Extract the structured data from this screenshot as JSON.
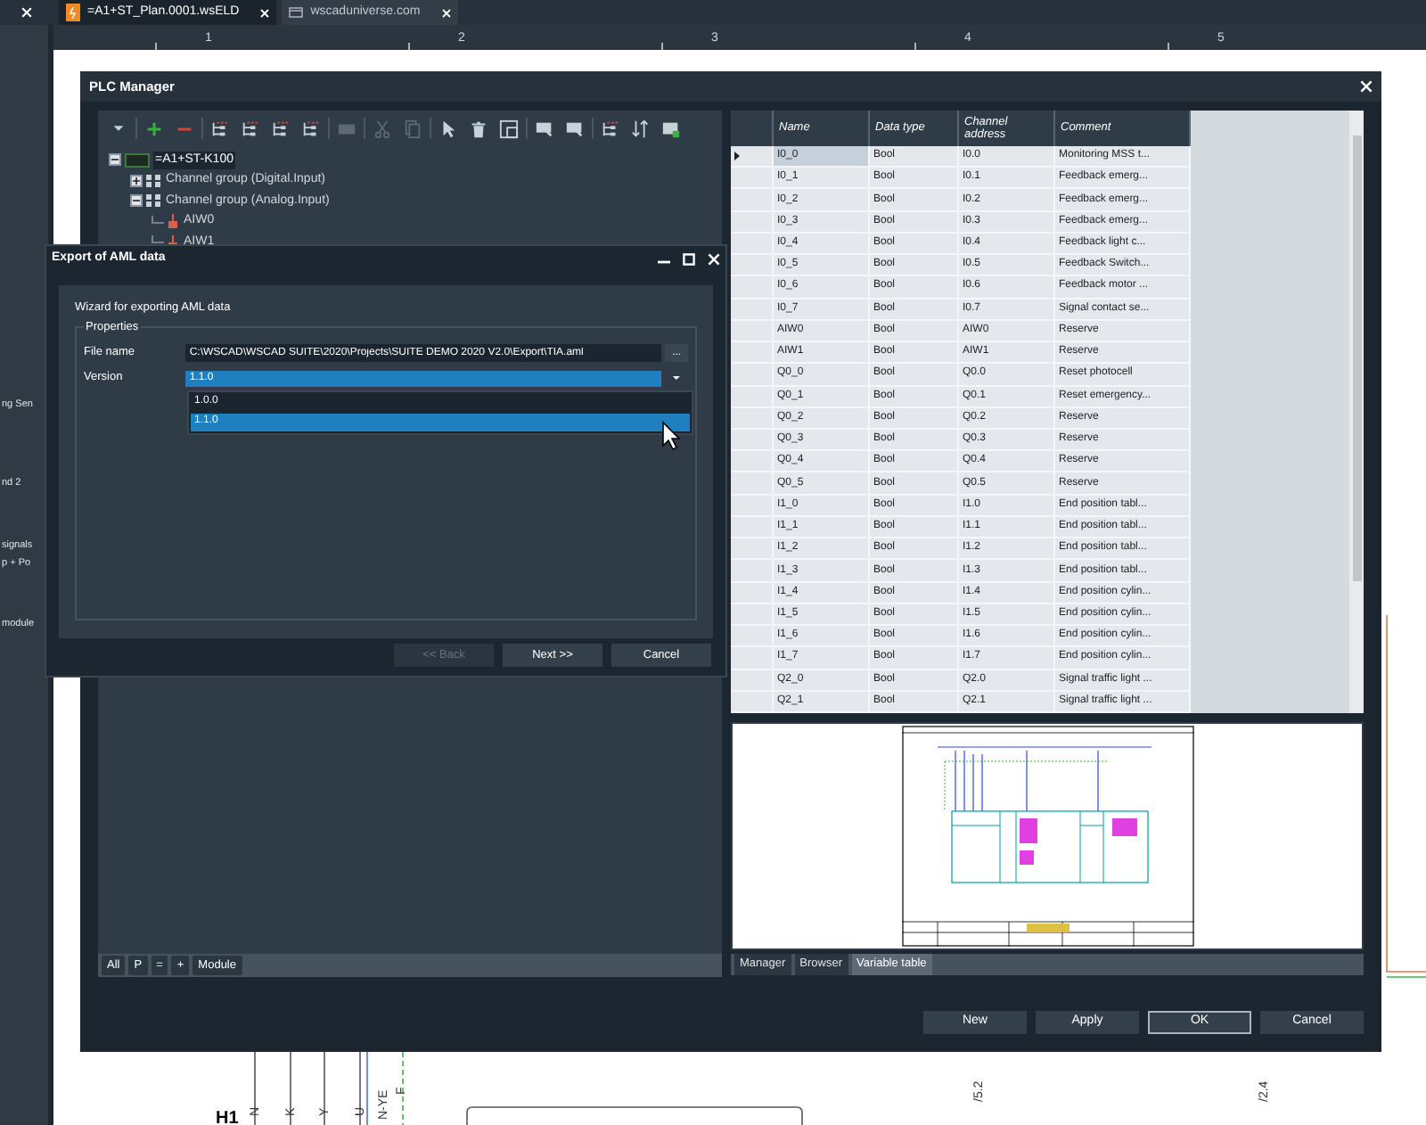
{
  "document_tabs": [
    {
      "label": "=A1+ST_Plan.0001.wsELD",
      "selected": true
    },
    {
      "label": "wscaduniverse.com",
      "selected": false
    }
  ],
  "side_panel": {
    "items": [
      "ng Sen",
      "nd 2",
      "signals",
      "p + Po",
      "module"
    ]
  },
  "ruler": [
    "1",
    "2",
    "3",
    "4",
    "5"
  ],
  "drawing_labels": [
    {
      "kind": "wire",
      "text": "N"
    },
    {
      "kind": "wire",
      "text": "K"
    },
    {
      "kind": "wire",
      "text": "Y"
    },
    {
      "kind": "wire",
      "text": "U"
    },
    {
      "kind": "wire",
      "text": "N-YE"
    },
    {
      "kind": "wire",
      "text": "F"
    },
    {
      "kind": "reference",
      "text": "/5.2"
    },
    {
      "kind": "reference",
      "text": "/2.4"
    },
    {
      "kind": "device",
      "text": "H1"
    }
  ],
  "plc_manager": {
    "title": "PLC Manager",
    "toolbar": [
      [
        {
          "kind": "dropdown",
          "disabled": false
        }
      ],
      [
        {
          "kind": "add",
          "disabled": false
        },
        {
          "kind": "remove",
          "disabled": false
        }
      ],
      [
        {
          "kind": "tree",
          "disabled": false
        },
        {
          "kind": "tree",
          "disabled": false
        },
        {
          "kind": "tree",
          "disabled": false
        },
        {
          "kind": "tree",
          "disabled": false
        }
      ],
      [
        {
          "kind": "module",
          "disabled": true
        }
      ],
      [
        {
          "kind": "cut",
          "disabled": true
        },
        {
          "kind": "copy",
          "disabled": true
        }
      ],
      [
        {
          "kind": "pointer",
          "disabled": false
        },
        {
          "kind": "delete",
          "disabled": false
        },
        {
          "kind": "layout",
          "disabled": false
        }
      ],
      [
        {
          "kind": "import",
          "disabled": false
        },
        {
          "kind": "import",
          "disabled": false
        }
      ],
      [
        {
          "kind": "tree",
          "disabled": false
        },
        {
          "kind": "sort",
          "disabled": false
        },
        {
          "kind": "export",
          "disabled": false
        }
      ]
    ],
    "tree": [
      {
        "kind": "module",
        "label": "=A1+ST-K100",
        "selected": true,
        "expanded": true,
        "children": [
          {
            "kind": "group",
            "label": "Channel group (Digital.Input)",
            "selected": false,
            "expanded": false
          },
          {
            "kind": "group",
            "label": "Channel group (Analog.Input)",
            "selected": false,
            "expanded": true,
            "children": [
              {
                "kind": "channel",
                "label": "AIW0",
                "selected": false
              },
              {
                "kind": "channel",
                "label": "AIW1",
                "selected": false
              }
            ]
          }
        ]
      }
    ],
    "filter_tabs": [
      "All",
      "P",
      "=",
      "+",
      "Module"
    ],
    "table": {
      "columns": [
        "Name",
        "Data type",
        "Channel address",
        "Comment"
      ],
      "rows": [
        {
          "selected": true,
          "cells": [
            "I0_0",
            "Bool",
            "I0.0",
            "Monitoring MSS t..."
          ]
        },
        {
          "selected": false,
          "cells": [
            "I0_1",
            "Bool",
            "I0.1",
            "Feedback emerg..."
          ]
        },
        {
          "selected": false,
          "cells": [
            "I0_2",
            "Bool",
            "I0.2",
            "Feedback emerg..."
          ]
        },
        {
          "selected": false,
          "cells": [
            "I0_3",
            "Bool",
            "I0.3",
            "Feedback emerg..."
          ]
        },
        {
          "selected": false,
          "cells": [
            "I0_4",
            "Bool",
            "I0.4",
            "Feedback light c..."
          ]
        },
        {
          "selected": false,
          "cells": [
            "I0_5",
            "Bool",
            "I0.5",
            "Feedback Switch..."
          ]
        },
        {
          "selected": false,
          "cells": [
            "I0_6",
            "Bool",
            "I0.6",
            "Feedback motor ..."
          ]
        },
        {
          "selected": false,
          "cells": [
            "I0_7",
            "Bool",
            "I0.7",
            "Signal contact se..."
          ]
        },
        {
          "selected": false,
          "cells": [
            "AIW0",
            "Bool",
            "AIW0",
            "Reserve"
          ]
        },
        {
          "selected": false,
          "cells": [
            "AIW1",
            "Bool",
            "AIW1",
            "Reserve"
          ]
        },
        {
          "selected": false,
          "cells": [
            "Q0_0",
            "Bool",
            "Q0.0",
            "Reset photocell"
          ]
        },
        {
          "selected": false,
          "cells": [
            "Q0_1",
            "Bool",
            "Q0.1",
            "Reset emergency..."
          ]
        },
        {
          "selected": false,
          "cells": [
            "Q0_2",
            "Bool",
            "Q0.2",
            "Reserve"
          ]
        },
        {
          "selected": false,
          "cells": [
            "Q0_3",
            "Bool",
            "Q0.3",
            "Reserve"
          ]
        },
        {
          "selected": false,
          "cells": [
            "Q0_4",
            "Bool",
            "Q0.4",
            "Reserve"
          ]
        },
        {
          "selected": false,
          "cells": [
            "Q0_5",
            "Bool",
            "Q0.5",
            "Reserve"
          ]
        },
        {
          "selected": false,
          "cells": [
            "I1_0",
            "Bool",
            "I1.0",
            "End position tabl..."
          ]
        },
        {
          "selected": false,
          "cells": [
            "I1_1",
            "Bool",
            "I1.1",
            "End position tabl..."
          ]
        },
        {
          "selected": false,
          "cells": [
            "I1_2",
            "Bool",
            "I1.2",
            "End position tabl..."
          ]
        },
        {
          "selected": false,
          "cells": [
            "I1_3",
            "Bool",
            "I1.3",
            "End position tabl..."
          ]
        },
        {
          "selected": false,
          "cells": [
            "I1_4",
            "Bool",
            "I1.4",
            "End position cylin..."
          ]
        },
        {
          "selected": false,
          "cells": [
            "I1_5",
            "Bool",
            "I1.5",
            "End position cylin..."
          ]
        },
        {
          "selected": false,
          "cells": [
            "I1_6",
            "Bool",
            "I1.6",
            "End position cylin..."
          ]
        },
        {
          "selected": false,
          "cells": [
            "I1_7",
            "Bool",
            "I1.7",
            "End position cylin..."
          ]
        },
        {
          "selected": false,
          "cells": [
            "Q2_0",
            "Bool",
            "Q2.0",
            "Signal traffic light ..."
          ]
        },
        {
          "selected": false,
          "cells": [
            "Q2_1",
            "Bool",
            "Q2.1",
            "Signal traffic light ..."
          ]
        }
      ]
    },
    "view_tabs": [
      {
        "label": "Manager",
        "selected": false
      },
      {
        "label": "Browser",
        "selected": false
      },
      {
        "label": "Variable table",
        "selected": true
      }
    ],
    "buttons": [
      {
        "label": "New",
        "focused": false
      },
      {
        "label": "Apply",
        "focused": false
      },
      {
        "label": "OK",
        "focused": true
      },
      {
        "label": "Cancel",
        "focused": false
      }
    ]
  },
  "export_dialog": {
    "title": "Export of AML data",
    "description": "Wizard for exporting AML data",
    "group_title": "Properties",
    "file_name": {
      "label": "File name",
      "value": "C:\\WSCAD\\WSCAD SUITE\\2020\\Projects\\SUITE DEMO 2020 V2.0\\Export\\TIA.aml"
    },
    "browse_button": "...",
    "version": {
      "label": "Version",
      "value": "1.1.0",
      "expanded": true,
      "options": [
        {
          "label": "1.0.0",
          "selected": false
        },
        {
          "label": "1.1.0",
          "selected": true
        }
      ]
    },
    "buttons": [
      {
        "label": "<< Back",
        "disabled": true
      },
      {
        "label": "Next >>",
        "disabled": false
      },
      {
        "label": "Cancel",
        "disabled": false
      }
    ]
  }
}
